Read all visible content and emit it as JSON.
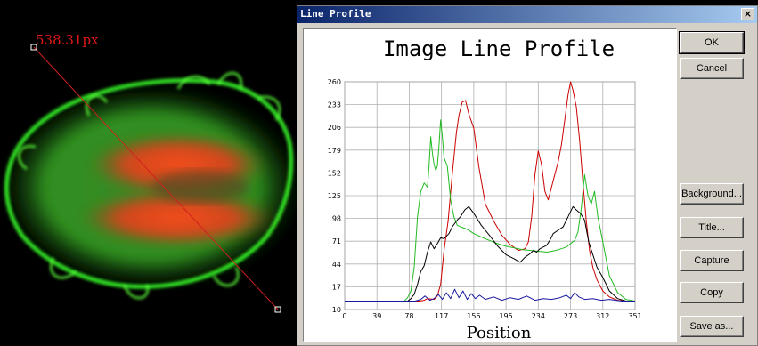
{
  "measurement": {
    "label": "538.31px",
    "line_color": "#d02020"
  },
  "dialog": {
    "title": "Line Profile",
    "close_label": "×",
    "buttons": {
      "ok": "OK",
      "cancel": "Cancel",
      "background": "Background...",
      "title": "Title...",
      "capture": "Capture",
      "copy": "Copy",
      "save_as": "Save as..."
    }
  },
  "chart_data": {
    "type": "line",
    "title": "Image Line Profile",
    "xlabel": "Position",
    "ylabel": "",
    "xlim": [
      0,
      351
    ],
    "ylim": [
      -10,
      260
    ],
    "x_ticks": [
      0,
      39,
      78,
      117,
      156,
      195,
      234,
      273,
      312,
      351
    ],
    "y_ticks": [
      -10,
      17,
      44,
      71,
      98,
      125,
      152,
      179,
      206,
      233,
      260
    ],
    "grid": true,
    "series": [
      {
        "color": "#cc0000",
        "x": [
          0,
          90,
          96,
          100,
          108,
          112,
          116,
          120,
          125,
          130,
          135,
          138,
          142,
          146,
          150,
          156,
          162,
          170,
          180,
          190,
          200,
          210,
          218,
          222,
          226,
          230,
          234,
          238,
          242,
          246,
          250,
          254,
          258,
          262,
          266,
          270,
          273,
          276,
          280,
          284,
          288,
          292,
          296,
          300,
          305,
          312,
          320,
          330,
          340,
          351
        ],
        "y": [
          0,
          0,
          1,
          3,
          2,
          6,
          20,
          60,
          95,
          150,
          200,
          220,
          236,
          238,
          222,
          205,
          160,
          115,
          95,
          78,
          67,
          60,
          62,
          70,
          100,
          150,
          178,
          162,
          130,
          120,
          135,
          150,
          165,
          185,
          215,
          245,
          260,
          250,
          230,
          190,
          140,
          95,
          60,
          40,
          25,
          12,
          5,
          1,
          0,
          0
        ]
      },
      {
        "color": "#22bb22",
        "x": [
          0,
          72,
          76,
          80,
          84,
          88,
          92,
          96,
          100,
          102,
          104,
          106,
          108,
          110,
          112,
          114,
          116,
          118,
          120,
          124,
          128,
          132,
          136,
          140,
          146,
          150,
          156,
          165,
          175,
          185,
          195,
          205,
          215,
          225,
          235,
          245,
          255,
          262,
          268,
          273,
          278,
          282,
          286,
          290,
          294,
          298,
          302,
          306,
          312,
          320,
          330,
          340,
          351
        ],
        "y": [
          0,
          0,
          4,
          12,
          40,
          100,
          130,
          140,
          135,
          160,
          195,
          175,
          162,
          155,
          160,
          185,
          215,
          195,
          170,
          160,
          120,
          100,
          90,
          88,
          86,
          84,
          80,
          76,
          72,
          68,
          65,
          63,
          61,
          60,
          59,
          58,
          60,
          62,
          64,
          68,
          72,
          82,
          110,
          150,
          125,
          115,
          130,
          100,
          70,
          30,
          10,
          2,
          0
        ]
      },
      {
        "color": "#000000",
        "x": [
          0,
          76,
          80,
          84,
          88,
          92,
          96,
          100,
          104,
          108,
          112,
          116,
          120,
          126,
          130,
          136,
          140,
          145,
          150,
          156,
          165,
          175,
          185,
          195,
          205,
          212,
          218,
          224,
          228,
          232,
          236,
          240,
          244,
          248,
          252,
          258,
          264,
          270,
          276,
          280,
          285,
          290,
          295,
          300,
          305,
          312,
          320,
          330,
          340,
          351
        ],
        "y": [
          0,
          0,
          3,
          8,
          20,
          35,
          42,
          58,
          70,
          62,
          68,
          75,
          74,
          80,
          88,
          96,
          100,
          108,
          112,
          104,
          90,
          78,
          65,
          55,
          50,
          46,
          52,
          56,
          60,
          58,
          62,
          64,
          66,
          72,
          80,
          84,
          88,
          100,
          112,
          108,
          104,
          96,
          70,
          55,
          40,
          28,
          12,
          3,
          0,
          0
        ]
      },
      {
        "color": "#1a1aa0",
        "x": [
          0,
          85,
          92,
          97,
          103,
          108,
          113,
          118,
          123,
          128,
          133,
          138,
          143,
          148,
          153,
          158,
          163,
          170,
          180,
          190,
          200,
          210,
          220,
          230,
          240,
          250,
          260,
          268,
          273,
          278,
          283,
          290,
          300,
          310,
          320,
          335,
          351
        ],
        "y": [
          0,
          0,
          2,
          6,
          1,
          3,
          8,
          2,
          10,
          3,
          14,
          4,
          12,
          2,
          9,
          3,
          7,
          2,
          5,
          1,
          4,
          2,
          6,
          1,
          3,
          2,
          4,
          7,
          3,
          10,
          5,
          2,
          3,
          1,
          2,
          0,
          0
        ]
      },
      {
        "color": "#d4a060",
        "x": [
          0,
          351
        ],
        "y": [
          -1,
          -1
        ]
      }
    ]
  }
}
